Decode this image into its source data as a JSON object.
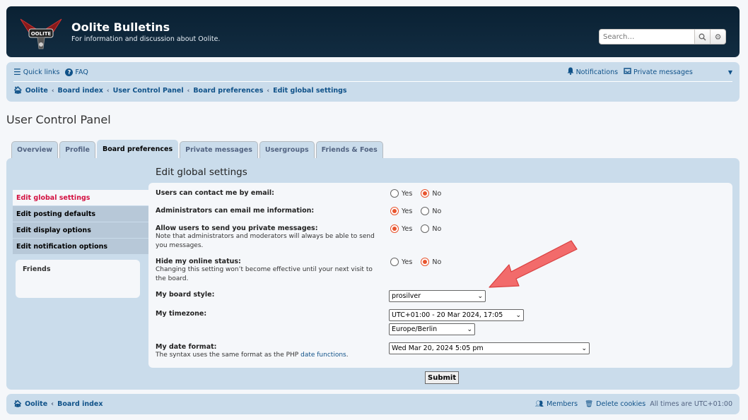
{
  "header": {
    "site_title": "Oolite Bulletins",
    "site_description": "For information and discussion about Oolite.",
    "logo_text": "OOLITE",
    "search_placeholder": "Search…"
  },
  "navbar": {
    "quick_links": "Quick links",
    "faq": "FAQ",
    "notifications": "Notifications",
    "private_messages": "Private messages",
    "breadcrumbs": [
      "Oolite",
      "Board index",
      "User Control Panel",
      "Board preferences",
      "Edit global settings"
    ]
  },
  "page_title": "User Control Panel",
  "tabs": [
    {
      "label": "Overview",
      "active": false
    },
    {
      "label": "Profile",
      "active": false
    },
    {
      "label": "Board preferences",
      "active": true
    },
    {
      "label": "Private messages",
      "active": false
    },
    {
      "label": "Usergroups",
      "active": false
    },
    {
      "label": "Friends & Foes",
      "active": false
    }
  ],
  "left_menu": [
    {
      "label": "Edit global settings",
      "active": true
    },
    {
      "label": "Edit posting defaults",
      "active": false
    },
    {
      "label": "Edit display options",
      "active": false
    },
    {
      "label": "Edit notification options",
      "active": false
    }
  ],
  "friends_title": "Friends",
  "content_title": "Edit global settings",
  "settings": {
    "contact_email": {
      "label": "Users can contact me by email:",
      "selected": "No"
    },
    "admin_email": {
      "label": "Administrators can email me information:",
      "selected": "Yes"
    },
    "allow_pm": {
      "label": "Allow users to send you private messages:",
      "explain": "Note that administrators and moderators will always be able to send you messages.",
      "selected": "Yes"
    },
    "hide_online": {
      "label": "Hide my online status:",
      "explain": "Changing this setting won’t become effective until your next visit to the board.",
      "selected": "No"
    },
    "yes_label": "Yes",
    "no_label": "No",
    "board_style": {
      "label": "My board style:",
      "value": "prosilver"
    },
    "timezone": {
      "label": "My timezone:",
      "value": "UTC+01:00 - 20 Mar 2024, 17:05",
      "zone": "Europe/Berlin"
    },
    "date_format": {
      "label": "My date format:",
      "explain_prefix": "The syntax uses the same format as the PHP ",
      "explain_link": "date functions",
      "explain_suffix": ".",
      "value": "Wed Mar 20, 2024 5:05 pm"
    }
  },
  "submit_label": "Submit",
  "footer": {
    "breadcrumbs": [
      "Oolite",
      "Board index"
    ],
    "members": "Members",
    "delete_cookies": "Delete cookies",
    "times_note": "All times are UTC+01:00"
  },
  "colors": {
    "header_bg": "#0a2133",
    "nav_bg": "#cadceb",
    "link": "#105289",
    "active_menu": "#d31141",
    "radio_checked": "#e8552f",
    "annotation_arrow": "#f25a5a"
  }
}
